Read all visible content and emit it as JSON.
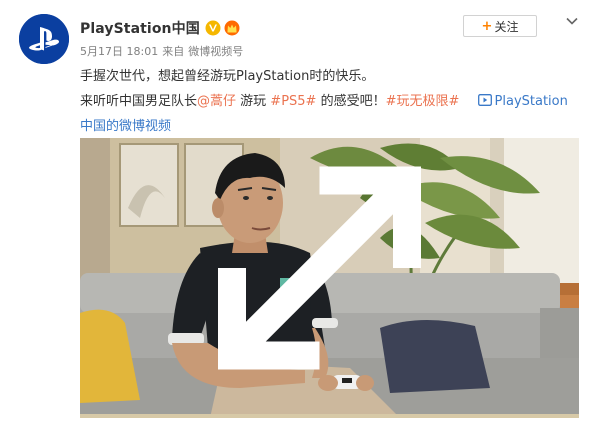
{
  "post": {
    "username": "PlayStation中国",
    "date": "5月17日 18:01",
    "source_prefix": "来自",
    "source": "微博视频号",
    "follow_label": "关注",
    "follow_plus": "+",
    "text_line1": "手握次世代，想起曾经游玩PlayStation时的快乐。",
    "text_line2_a": "来听听中国男足队长",
    "mention": "@蒿仔",
    "text_line2_b": " 游玩 ",
    "hashtag1": "#PS5#",
    "text_line2_c": " 的感受吧！",
    "hashtag2": "#玩无极限#",
    "video_link_a": "PlayStation",
    "video_link_b": "中国的微博视频"
  },
  "icons": {
    "avatar": "playstation-logo",
    "verified": "verified-v-icon",
    "member": "crown-icon",
    "menu": "chevron-down-icon",
    "video_link": "video-icon",
    "fullscreen": "expand-icon"
  },
  "colors": {
    "accent_orange": "#ff8200",
    "link_orange": "#eb7350",
    "link_blue": "#3a79c8",
    "verified_gold": "#f5b700",
    "avatar_blue": "#0b3fa0"
  }
}
